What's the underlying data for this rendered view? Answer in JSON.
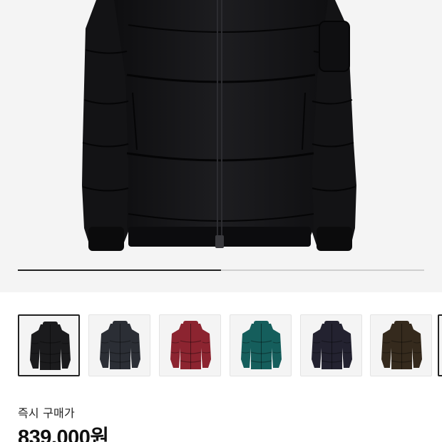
{
  "gallery": {
    "progress_fraction": 0.5,
    "main_image": "black-puffer-jacket"
  },
  "thumbnails": [
    {
      "color": "#1b1b1d",
      "icon": "black-puffer-jacket",
      "selected": true
    },
    {
      "color": "#2b2e35",
      "icon": "charcoal-puffer-jacket",
      "selected": false
    },
    {
      "color": "#8c2430",
      "icon": "red-puffer-jacket",
      "selected": false
    },
    {
      "color": "#155e5c",
      "icon": "teal-puffer-jacket",
      "selected": false
    },
    {
      "color": "#232230",
      "icon": "navy-puffer-jacket",
      "selected": false
    },
    {
      "color": "#352a1d",
      "icon": "brown-puffer-jacket",
      "selected": false
    }
  ],
  "price": {
    "label": "즉시 구매가",
    "value": "839,000원"
  }
}
